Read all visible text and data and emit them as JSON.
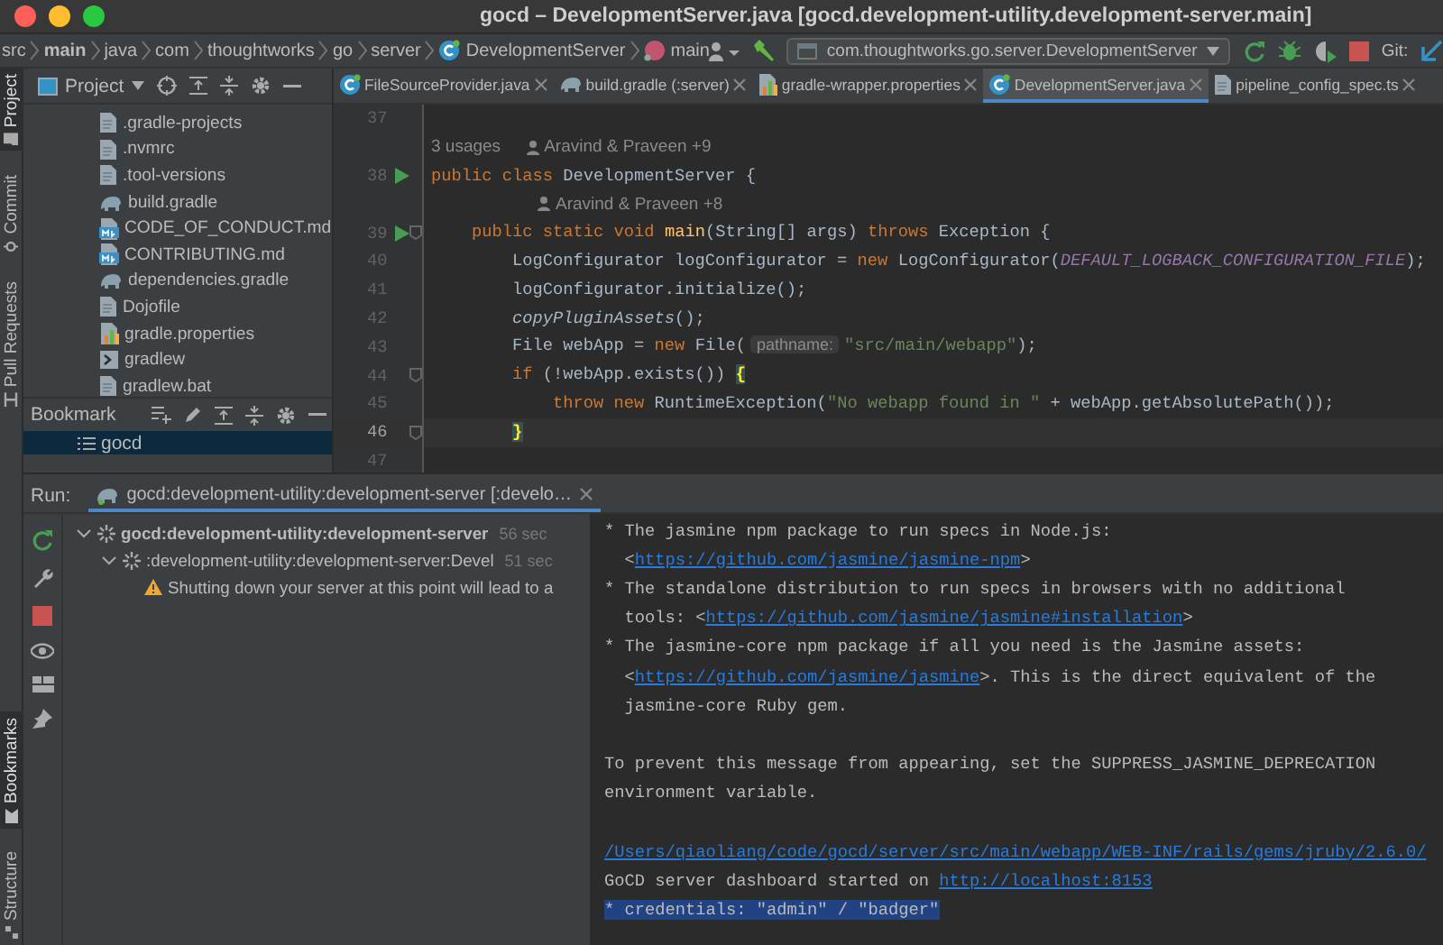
{
  "window": {
    "title": "gocd – DevelopmentServer.java [gocd.development-utility.development-server.main]"
  },
  "breadcrumbs": [
    {
      "label": "src",
      "kind": "folder"
    },
    {
      "label": "main",
      "kind": "module"
    },
    {
      "label": "java",
      "kind": "folder"
    },
    {
      "label": "com",
      "kind": "folder"
    },
    {
      "label": "thoughtworks",
      "kind": "folder"
    },
    {
      "label": "go",
      "kind": "folder"
    },
    {
      "label": "server",
      "kind": "folder"
    },
    {
      "label": "DevelopmentServer",
      "kind": "class"
    },
    {
      "label": "main",
      "kind": "method"
    }
  ],
  "toolbar": {
    "run_config": "com.thoughtworks.go.server.DevelopmentServer",
    "vcs_label": "Git:"
  },
  "left_stripe": {
    "top": [
      {
        "label": "Project",
        "selected": true
      },
      {
        "label": "Commit",
        "selected": false
      },
      {
        "label": "Pull Requests",
        "selected": false
      }
    ],
    "bottom": [
      {
        "label": "Bookmarks",
        "selected": true
      },
      {
        "label": "Structure",
        "selected": false
      }
    ]
  },
  "project_panel": {
    "title": "Project",
    "files": [
      {
        "name": ".gradle-projects",
        "kind": "file"
      },
      {
        "name": ".nvmrc",
        "kind": "file"
      },
      {
        "name": ".tool-versions",
        "kind": "file"
      },
      {
        "name": "build.gradle",
        "kind": "gradle"
      },
      {
        "name": "CODE_OF_CONDUCT.md",
        "kind": "markdown"
      },
      {
        "name": "CONTRIBUTING.md",
        "kind": "markdown"
      },
      {
        "name": "dependencies.gradle",
        "kind": "gradle"
      },
      {
        "name": "Dojofile",
        "kind": "file"
      },
      {
        "name": "gradle.properties",
        "kind": "properties"
      },
      {
        "name": "gradlew",
        "kind": "script"
      },
      {
        "name": "gradlew.bat",
        "kind": "file"
      }
    ]
  },
  "bookmarks_panel": {
    "title": "Bookmark",
    "items": [
      {
        "label": "gocd",
        "selected": true
      }
    ]
  },
  "editor": {
    "tabs": [
      {
        "label": "FileSourceProvider.java",
        "kind": "java",
        "selected": false
      },
      {
        "label": "build.gradle (:server)",
        "kind": "gradle",
        "selected": false
      },
      {
        "label": "gradle-wrapper.properties",
        "kind": "properties",
        "selected": false
      },
      {
        "label": "DevelopmentServer.java",
        "kind": "class",
        "selected": true
      },
      {
        "label": "pipeline_config_spec.ts",
        "kind": "file",
        "selected": false
      }
    ],
    "lines": [
      {
        "kind": "code",
        "number": "37",
        "run": false,
        "fold": false,
        "current": false
      },
      {
        "kind": "inlay",
        "usages": "3 usages",
        "author": "Aravind & Praveen +9"
      },
      {
        "kind": "code",
        "number": "38",
        "run": true,
        "fold": false,
        "current": false,
        "segments": [
          {
            "text": "public class",
            "kind": "keyword"
          },
          {
            "text": " DevelopmentServer {",
            "kind": "plain"
          }
        ]
      },
      {
        "kind": "inlay",
        "author": "Aravind & Praveen +8"
      },
      {
        "kind": "code",
        "number": "39",
        "run": true,
        "fold": true,
        "current": false,
        "segments": [
          {
            "text": "    public static void",
            "kind": "keyword"
          },
          {
            "text": " main",
            "kind": "method"
          },
          {
            "text": "(String[] args) ",
            "kind": "plain"
          },
          {
            "text": "throws",
            "kind": "keyword"
          },
          {
            "text": " Exception {",
            "kind": "plain"
          }
        ]
      },
      {
        "kind": "code",
        "number": "40",
        "run": false,
        "fold": false,
        "current": false,
        "segments": [
          {
            "text": "        LogConfigurator logConfigurator = ",
            "kind": "plain"
          },
          {
            "text": "new",
            "kind": "keyword"
          },
          {
            "text": " LogConfigurator(",
            "kind": "plain"
          },
          {
            "text": "DEFAULT_LOGBACK_CONFIGURATION_FILE",
            "kind": "constant"
          },
          {
            "text": ");",
            "kind": "plain"
          }
        ]
      },
      {
        "kind": "code",
        "number": "41",
        "run": false,
        "fold": false,
        "current": false,
        "segments": [
          {
            "text": "        logConfigurator.initialize();",
            "kind": "plain"
          }
        ]
      },
      {
        "kind": "code",
        "number": "42",
        "run": false,
        "fold": false,
        "current": false,
        "segments": [
          {
            "text": "        copyPluginAssets",
            "kind": "static-call"
          },
          {
            "text": "();",
            "kind": "plain"
          }
        ]
      },
      {
        "kind": "code",
        "number": "43",
        "run": false,
        "fold": false,
        "current": false,
        "segments": [
          {
            "text": "        File webApp = ",
            "kind": "plain"
          },
          {
            "text": "new",
            "kind": "keyword"
          },
          {
            "text": " File(",
            "kind": "plain"
          },
          {
            "text": "pathname:",
            "kind": "hint"
          },
          {
            "text": "\"src/main/webapp\"",
            "kind": "string"
          },
          {
            "text": ");",
            "kind": "plain"
          }
        ]
      },
      {
        "kind": "code",
        "number": "44",
        "run": false,
        "fold": true,
        "current": false,
        "segments": [
          {
            "text": "        if",
            "kind": "keyword"
          },
          {
            "text": " (!webApp.exists()) ",
            "kind": "plain"
          },
          {
            "text": "{",
            "kind": "brace"
          }
        ]
      },
      {
        "kind": "code",
        "number": "45",
        "run": false,
        "fold": false,
        "current": false,
        "segments": [
          {
            "text": "            throw new",
            "kind": "keyword"
          },
          {
            "text": " RuntimeException(",
            "kind": "plain"
          },
          {
            "text": "\"No webapp found in \"",
            "kind": "string"
          },
          {
            "text": " + webApp.getAbsolutePath());",
            "kind": "plain"
          }
        ]
      },
      {
        "kind": "code",
        "number": "46",
        "run": false,
        "fold": true,
        "current": true,
        "segments": [
          {
            "text": "        }",
            "kind": "brace"
          }
        ]
      },
      {
        "kind": "code",
        "number": "47",
        "run": false,
        "fold": false,
        "current": false
      }
    ]
  },
  "run_panel": {
    "label": "Run:",
    "tab": "gocd:development-utility:development-server [:develo…",
    "tree": [
      {
        "label": "gocd:development-utility:development-server",
        "kind": "task",
        "time": "56 sec",
        "expanded": true,
        "children": [
          {
            "label": ":development-utility:development-server:Devel",
            "kind": "task",
            "time": "51 sec",
            "expanded": true,
            "children": [
              {
                "label": "Shutting down your server at this point will lead to a",
                "kind": "warning"
              }
            ]
          }
        ]
      }
    ],
    "console": [
      {
        "segments": [
          {
            "text": "* The jasmine npm package to run specs in Node.js:",
            "kind": "plain"
          }
        ]
      },
      {
        "segments": [
          {
            "text": "  <",
            "kind": "plain"
          },
          {
            "text": "https://github.com/jasmine/jasmine-npm",
            "kind": "link"
          },
          {
            "text": ">",
            "kind": "plain"
          }
        ]
      },
      {
        "segments": [
          {
            "text": "* The standalone distribution to run specs in browsers with no additional",
            "kind": "plain"
          }
        ]
      },
      {
        "segments": [
          {
            "text": "  tools: <",
            "kind": "plain"
          },
          {
            "text": "https://github.com/jasmine/jasmine#installation",
            "kind": "link"
          },
          {
            "text": ">",
            "kind": "plain"
          }
        ]
      },
      {
        "segments": [
          {
            "text": "* The jasmine-core npm package if all you need is the Jasmine assets:",
            "kind": "plain"
          }
        ]
      },
      {
        "segments": [
          {
            "text": "  <",
            "kind": "plain"
          },
          {
            "text": "https://github.com/jasmine/jasmine",
            "kind": "link"
          },
          {
            "text": ">. This is the direct equivalent of the",
            "kind": "plain"
          }
        ]
      },
      {
        "segments": [
          {
            "text": "  jasmine-core Ruby gem.",
            "kind": "plain"
          }
        ]
      },
      {
        "gap_before": true,
        "segments": [
          {
            "text": "To prevent this message from appearing, set the SUPPRESS_JASMINE_DEPRECATION",
            "kind": "plain"
          }
        ]
      },
      {
        "segments": [
          {
            "text": "environment variable.",
            "kind": "plain"
          }
        ]
      },
      {
        "gap_before": true,
        "segments": [
          {
            "text": "/Users/qiaoliang/code/gocd/server/src/main/webapp/WEB-INF/rails/gems/jruby/2.6.0/",
            "kind": "link"
          }
        ]
      },
      {
        "segments": [
          {
            "text": "GoCD server dashboard started on ",
            "kind": "plain"
          },
          {
            "text": "http://localhost:8153",
            "kind": "link"
          }
        ]
      },
      {
        "selected": true,
        "segments": [
          {
            "text": "* credentials: \"admin\" / \"badger\"",
            "kind": "plain"
          }
        ]
      }
    ]
  }
}
